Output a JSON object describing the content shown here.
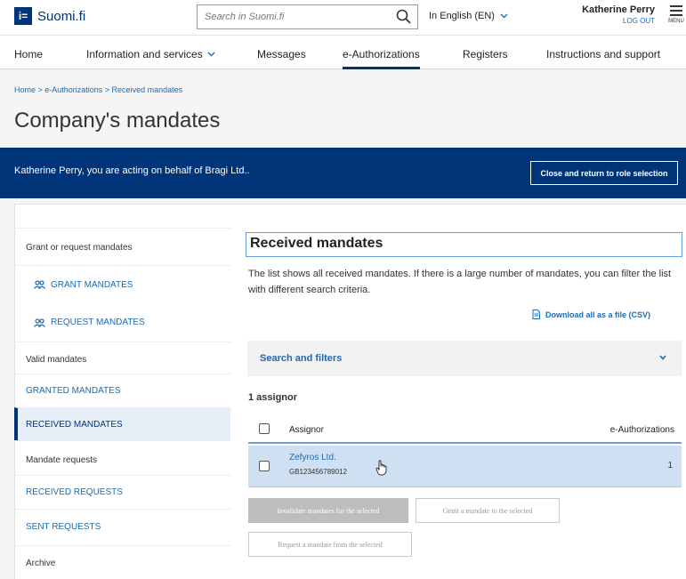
{
  "header": {
    "logo_text": "Suomi.fi",
    "logo_mark": "i=",
    "search_placeholder": "Search in Suomi.fi",
    "language": "In English (EN)",
    "user_name": "Katherine Perry",
    "logout": "LOG OUT",
    "menu": "MENU"
  },
  "nav": {
    "items": [
      "Home",
      "Information and services",
      "Messages",
      "e-Authorizations",
      "Registers",
      "Instructions and support"
    ],
    "active": "e-Authorizations"
  },
  "breadcrumb": "Home > e-Authorizations > Received mandates",
  "page_title": "Company's mandates",
  "banner": {
    "text": "Katherine Perry, you are acting on behalf of Bragi Ltd..",
    "button": "Close and return to role selection"
  },
  "sidebar": {
    "grant_request_heading": "Grant or request mandates",
    "grant_mandates": "GRANT MANDATES",
    "request_mandates": "REQUEST MANDATES",
    "valid_heading": "Valid mandates",
    "granted_mandates": "GRANTED MANDATES",
    "received_mandates": "RECEIVED MANDATES",
    "requests_heading": "Mandate requests",
    "received_requests": "RECEIVED REQUESTS",
    "sent_requests": "SENT REQUESTS",
    "archive_heading": "Archive"
  },
  "main": {
    "title": "Received mandates",
    "description": "The list shows all received mandates. If there is a large number of mandates, you can filter the list with different search criteria.",
    "csv_link": "Download all as a file (CSV)",
    "filters_label": "Search and filters",
    "count": "1 assignor",
    "table": {
      "col_assignor": "Assignor",
      "col_eauth": "e-Authorizations",
      "rows": [
        {
          "name": "Zefyros Ltd.",
          "id": "GB123456789012",
          "count": "1"
        }
      ]
    },
    "btn_invalidate": "Invalidate mandates for the selected",
    "btn_grant": "Grant a mandate to the selected",
    "btn_request": "Request a mandate from the selected"
  },
  "colors": {
    "brand_navy": "#003479",
    "link_blue": "#1a6bb5",
    "selected_row": "#cfe0f3"
  }
}
